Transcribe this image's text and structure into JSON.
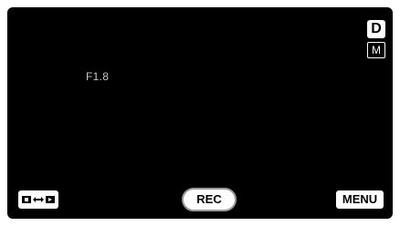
{
  "viewfinder": {
    "aperture": "F1.8"
  },
  "indicators": {
    "d_badge": "D",
    "m_badge": "M"
  },
  "controls": {
    "mode_switch_icon": "camera-video-switch-icon",
    "rec_label": "REC",
    "menu_label": "MENU"
  },
  "colors": {
    "screen_bg": "#000000",
    "button_bg": "#ffffff",
    "aperture_text": "#c8c8c8"
  }
}
